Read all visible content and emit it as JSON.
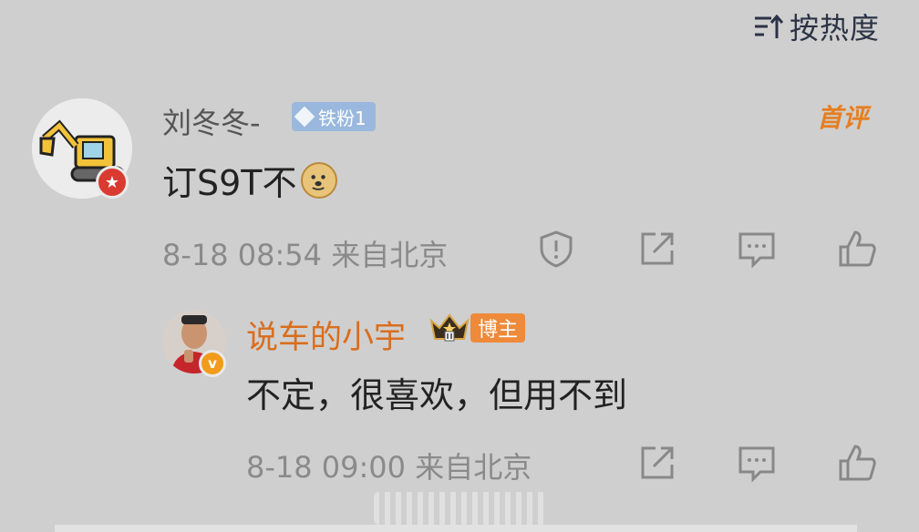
{
  "sort": {
    "label": "按热度",
    "icon": "sort-icon"
  },
  "comments": [
    {
      "username": "刘冬冬-",
      "fan_badge": "铁粉1",
      "first_badge": "首评",
      "text": "订S9T不",
      "emoji": "doge-emoji",
      "meta": "8-18 08:54 来自北京",
      "actions": [
        "report-icon",
        "share-icon",
        "comment-icon",
        "like-icon"
      ]
    },
    {
      "username": "说车的小宇",
      "rank_badge": "crown-badge-icon",
      "blogger_badge": "博主",
      "verified_badge": "v",
      "text": "不定，很喜欢，但用不到",
      "meta": "8-18 09:00 来自北京",
      "actions": [
        "share-icon",
        "comment-icon",
        "like-icon"
      ]
    }
  ],
  "colors": {
    "background": "#cfcfcf",
    "username_primary": "#555555",
    "blogger_name": "#d96e1e",
    "first_comment": "#e57f22",
    "fan_badge": "#9ab8dd",
    "meta_text": "#8a8a8a"
  }
}
